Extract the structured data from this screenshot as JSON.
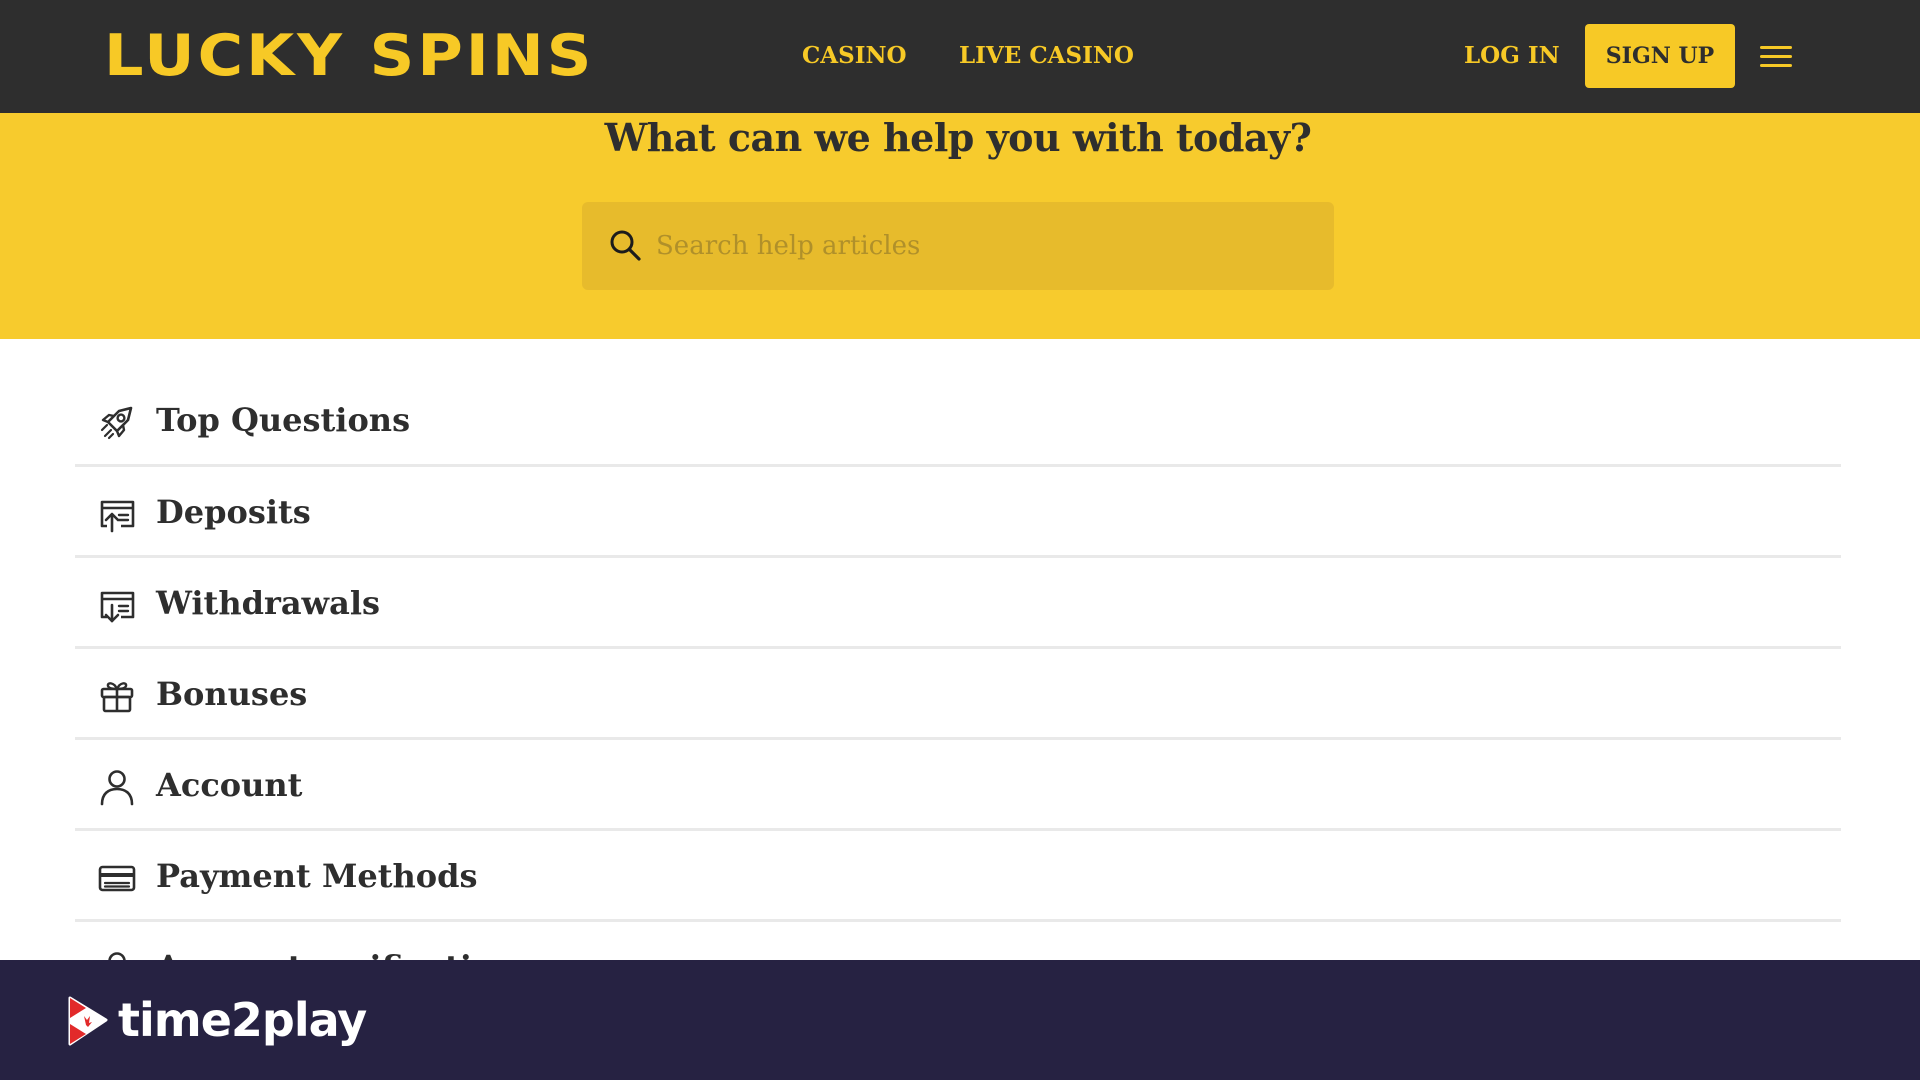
{
  "header": {
    "logo_text": "LUCKY SPINS",
    "nav": {
      "casino": "CASINO",
      "live_casino": "LIVE CASINO",
      "login": "LOG IN",
      "signup": "SIGN UP"
    },
    "menu_icon": "hamburger-menu-icon"
  },
  "hero": {
    "title": "What can we help you with today?",
    "search": {
      "placeholder": "Search help articles",
      "value": "",
      "icon": "search-icon"
    }
  },
  "categories": [
    {
      "label": "Top Questions",
      "icon": "rocket-icon"
    },
    {
      "label": "Deposits",
      "icon": "deposit-icon"
    },
    {
      "label": "Withdrawals",
      "icon": "withdrawal-icon"
    },
    {
      "label": "Bonuses",
      "icon": "gift-icon"
    },
    {
      "label": "Account",
      "icon": "user-icon"
    },
    {
      "label": "Payment Methods",
      "icon": "credit-card-icon"
    },
    {
      "label": "Account verification",
      "icon": "verification-icon"
    }
  ],
  "footer": {
    "brand_text": "time2play",
    "brand_icon": "time2play-logo-icon"
  },
  "colors": {
    "header_bg": "#2e2e2e",
    "accent_yellow": "#f7c926",
    "hero_bg": "#f7cb2d",
    "search_bg": "#e7bb2c",
    "footer_bg": "#262242",
    "text_dark": "#2e2e2e",
    "divider": "#e9e9e9"
  }
}
